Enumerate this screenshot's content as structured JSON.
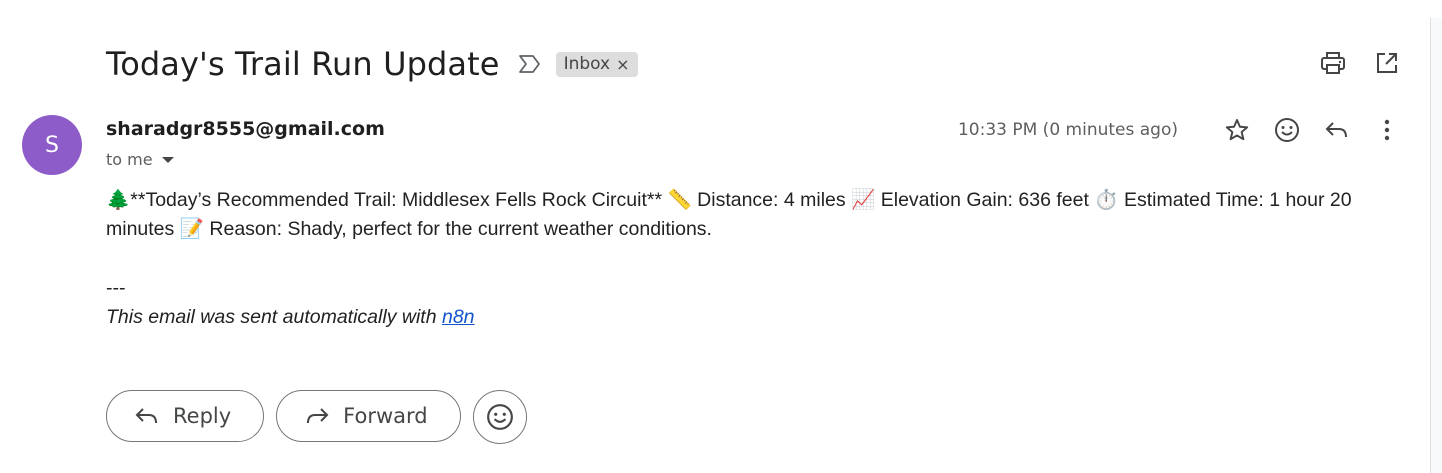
{
  "email": {
    "subject": "Today's Trail Run Update",
    "label": "Inbox",
    "label_remove": "×",
    "sender_initial": "S",
    "sender": "sharadgr8555@gmail.com",
    "recipient": "to me",
    "timestamp": "10:33 PM (0 minutes ago)",
    "body_line": "🌲**Today’s Recommended Trail: Middlesex Fells Rock Circuit** 📏 Distance: 4 miles 📈 Elevation Gain: 636 feet ⏱️ Estimated Time: 1 hour 20 minutes 📝 Reason: Shady, perfect for the current weather conditions.",
    "separator": "---",
    "footer_prefix": "This email was sent automatically with ",
    "footer_link": "n8n"
  },
  "actions": {
    "reply": "Reply",
    "forward": "Forward"
  },
  "icons": {
    "important": "important-marker-icon",
    "print": "print-icon",
    "open_new_window": "open-in-new-window-icon",
    "star": "star-icon",
    "emoji": "emoji-reaction-icon",
    "reply": "reply-icon",
    "more": "more-vert-icon",
    "forward": "forward-icon",
    "caret": "caret-down-icon"
  },
  "colors": {
    "avatar": "#8e5cc9",
    "link": "#1155cc",
    "chip": "#dddddd"
  }
}
